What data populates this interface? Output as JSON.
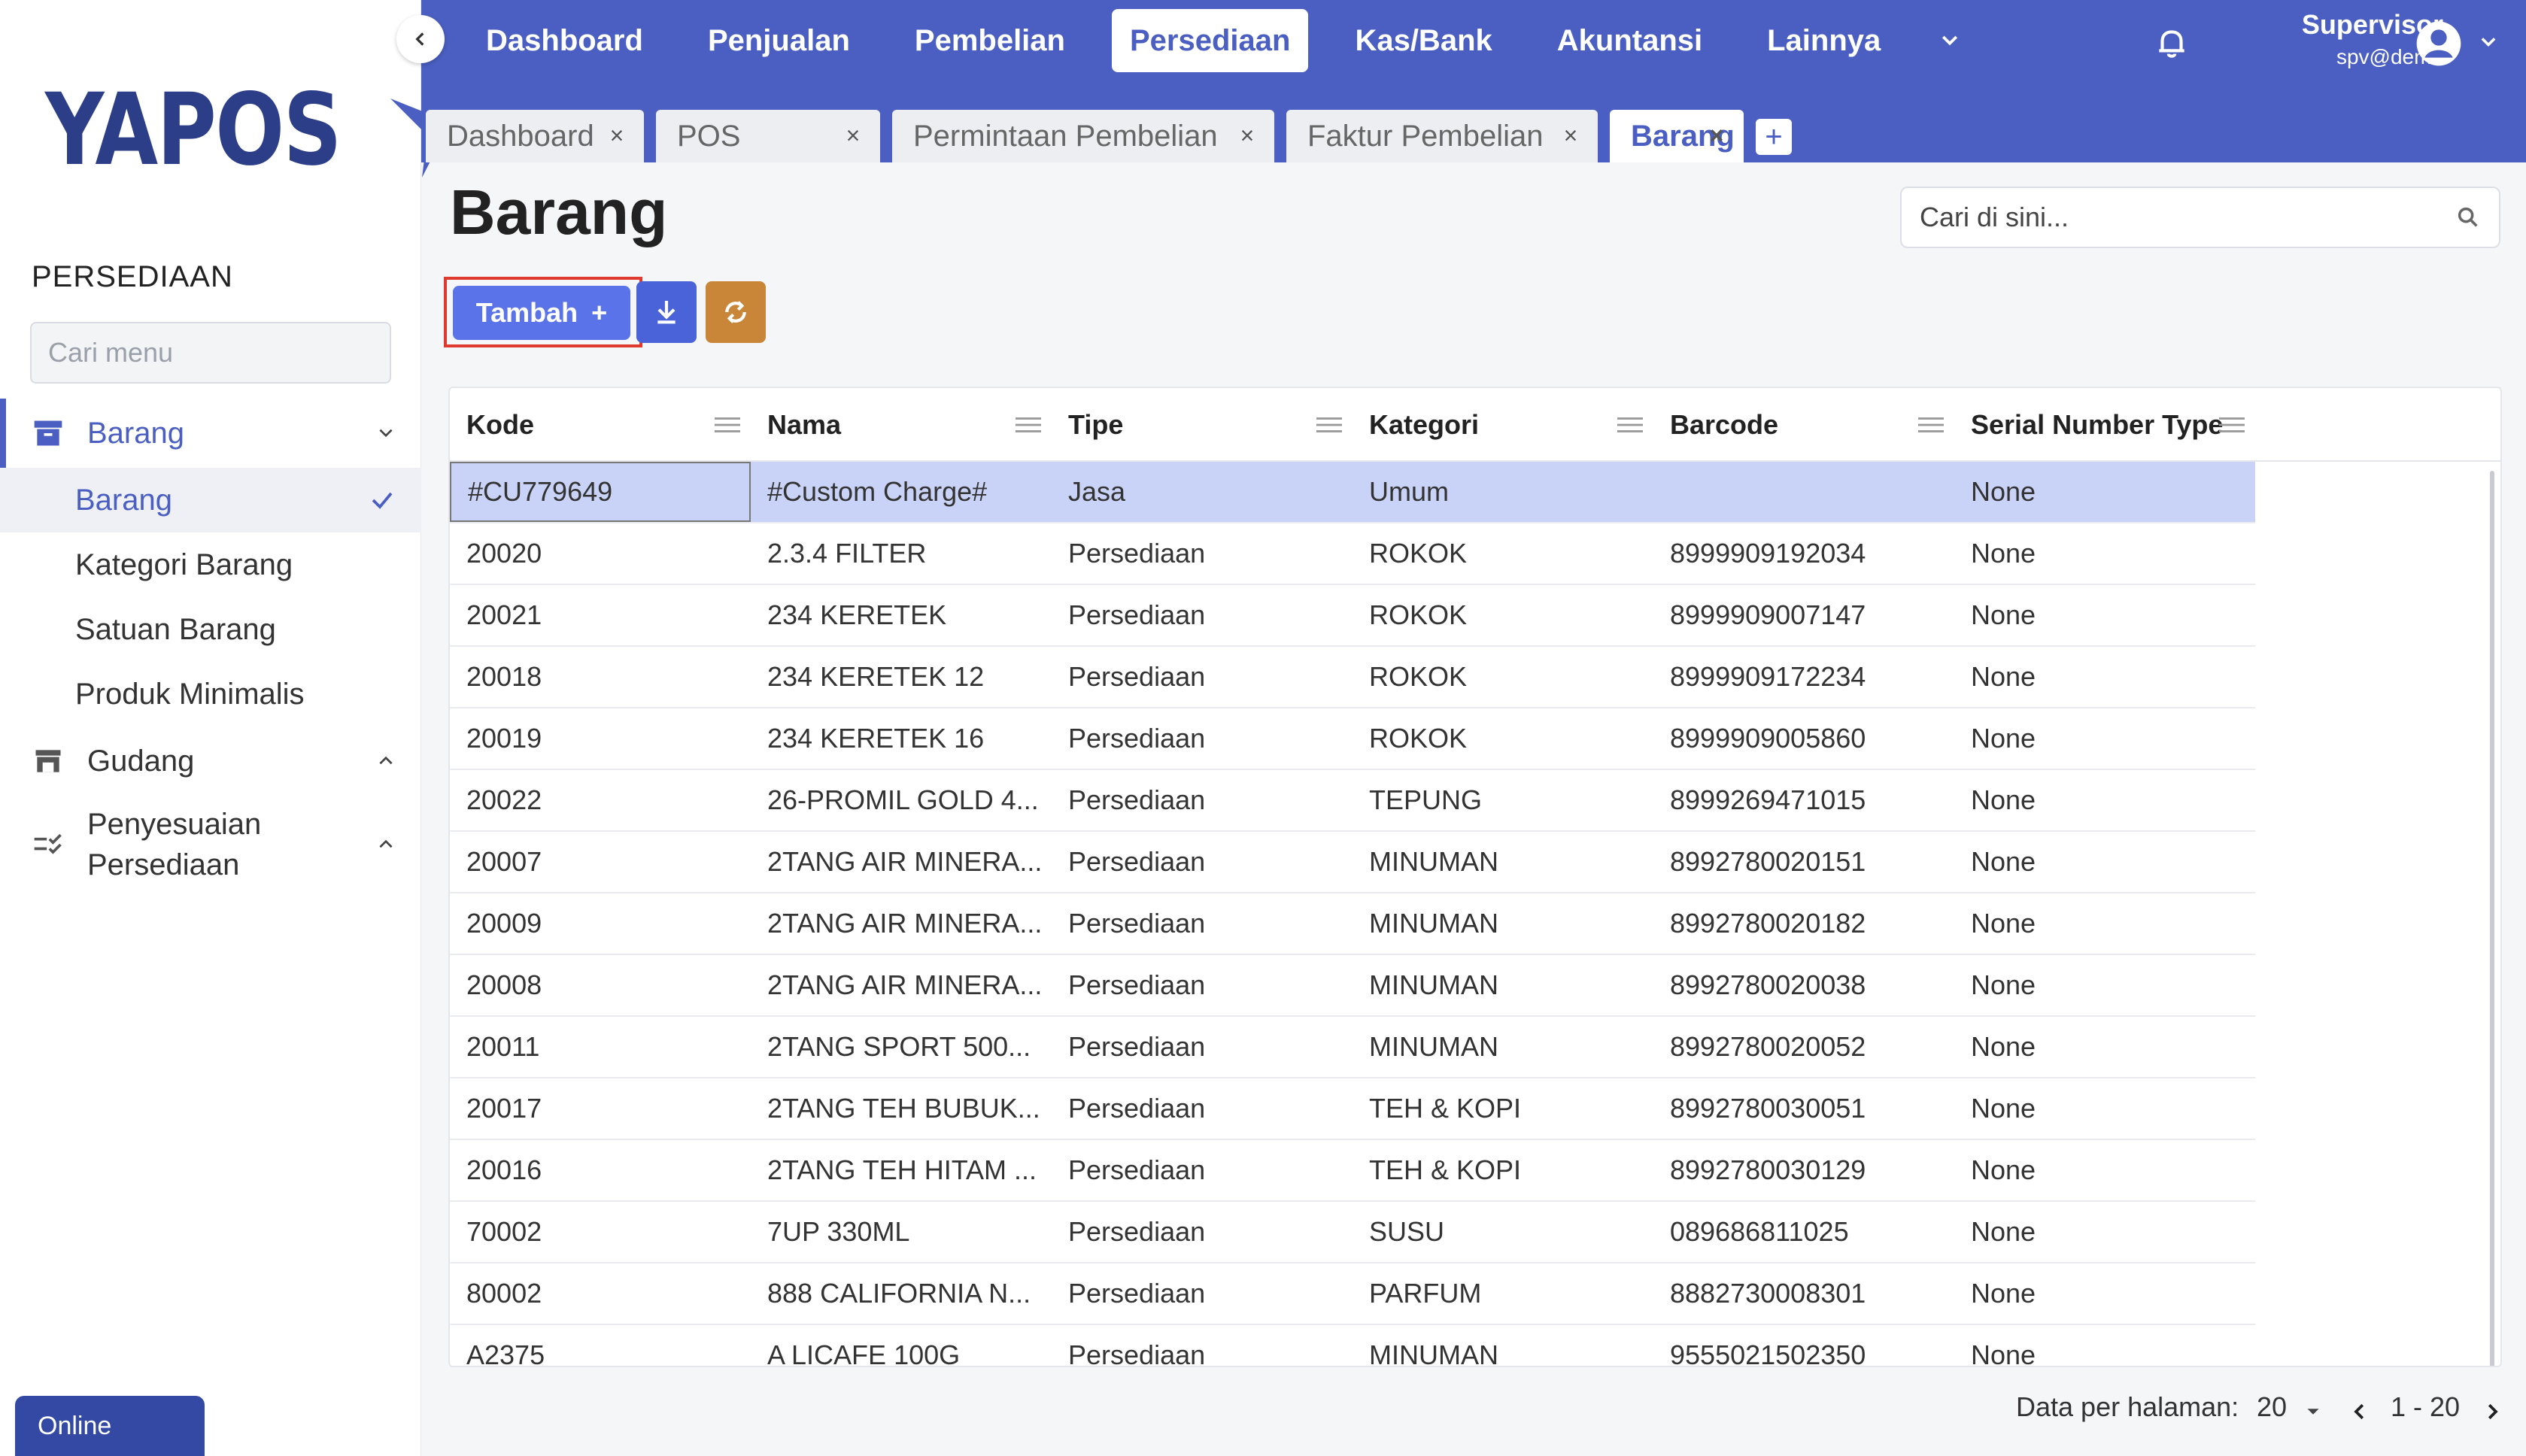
{
  "brand": {
    "logo_text": "YAPOS"
  },
  "sidebar": {
    "section_title": "PERSEDIAAN",
    "search_placeholder": "Cari menu",
    "groups": [
      {
        "label": "Barang",
        "expanded": true
      },
      {
        "label": "Gudang",
        "expanded": false
      },
      {
        "label": "Penyesuaian Persediaan",
        "expanded": false
      }
    ],
    "sub_items": [
      "Barang",
      "Kategori Barang",
      "Satuan Barang",
      "Produk Minimalis"
    ],
    "status": "Online"
  },
  "topnav": {
    "items": [
      "Dashboard",
      "Penjualan",
      "Pembelian",
      "Persediaan",
      "Kas/Bank",
      "Akuntansi",
      "Lainnya"
    ],
    "active": "Persediaan",
    "user_name": "Supervisor",
    "user_id": "spv@demo"
  },
  "tabs": [
    "Dashboard",
    "POS",
    "Permintaan Pembelian",
    "Faktur Pembelian",
    "Barang"
  ],
  "page": {
    "title": "Barang",
    "search_placeholder": "Cari di sini...",
    "add_button": "Tambah"
  },
  "table": {
    "columns": [
      "Kode",
      "Nama",
      "Tipe",
      "Kategori",
      "Barcode",
      "Serial Number Type"
    ],
    "rows": [
      [
        "#CU779649",
        "#Custom Charge#",
        "Jasa",
        "Umum",
        "",
        "None"
      ],
      [
        "20020",
        "2.3.4 FILTER",
        "Persediaan",
        "ROKOK",
        "8999909192034",
        "None"
      ],
      [
        "20021",
        "234 KERETEK",
        "Persediaan",
        "ROKOK",
        "8999909007147",
        "None"
      ],
      [
        "20018",
        "234 KERETEK 12",
        "Persediaan",
        "ROKOK",
        "8999909172234",
        "None"
      ],
      [
        "20019",
        "234 KERETEK 16",
        "Persediaan",
        "ROKOK",
        "8999909005860",
        "None"
      ],
      [
        "20022",
        "26-PROMIL GOLD 4...",
        "Persediaan",
        "TEPUNG",
        "8999269471015",
        "None"
      ],
      [
        "20007",
        "2TANG AIR MINERA...",
        "Persediaan",
        "MINUMAN",
        "8992780020151",
        "None"
      ],
      [
        "20009",
        "2TANG AIR MINERA...",
        "Persediaan",
        "MINUMAN",
        "8992780020182",
        "None"
      ],
      [
        "20008",
        "2TANG AIR MINERA...",
        "Persediaan",
        "MINUMAN",
        "8992780020038",
        "None"
      ],
      [
        "20011",
        "2TANG SPORT 500...",
        "Persediaan",
        "MINUMAN",
        "8992780020052",
        "None"
      ],
      [
        "20017",
        "2TANG TEH BUBUK...",
        "Persediaan",
        "TEH & KOPI",
        "8992780030051",
        "None"
      ],
      [
        "20016",
        "2TANG TEH HITAM ...",
        "Persediaan",
        "TEH & KOPI",
        "8992780030129",
        "None"
      ],
      [
        "70002",
        "7UP 330ML",
        "Persediaan",
        "SUSU",
        "089686811025",
        "None"
      ],
      [
        "80002",
        "888 CALIFORNIA N...",
        "Persediaan",
        "PARFUM",
        "8882730008301",
        "None"
      ],
      [
        "A2375",
        "A LICAFE 100G",
        "Persediaan",
        "MINUMAN",
        "9555021502350",
        "None"
      ]
    ]
  },
  "pagination": {
    "label": "Data per halaman:",
    "per_page": "20",
    "range": "1 - 20"
  },
  "colors": {
    "primary": "#4a5fc1",
    "button_blue": "#5b73e8",
    "sync_orange": "#c98639",
    "highlight_red": "#e03a2f",
    "selected_row": "#c9d3f7"
  }
}
